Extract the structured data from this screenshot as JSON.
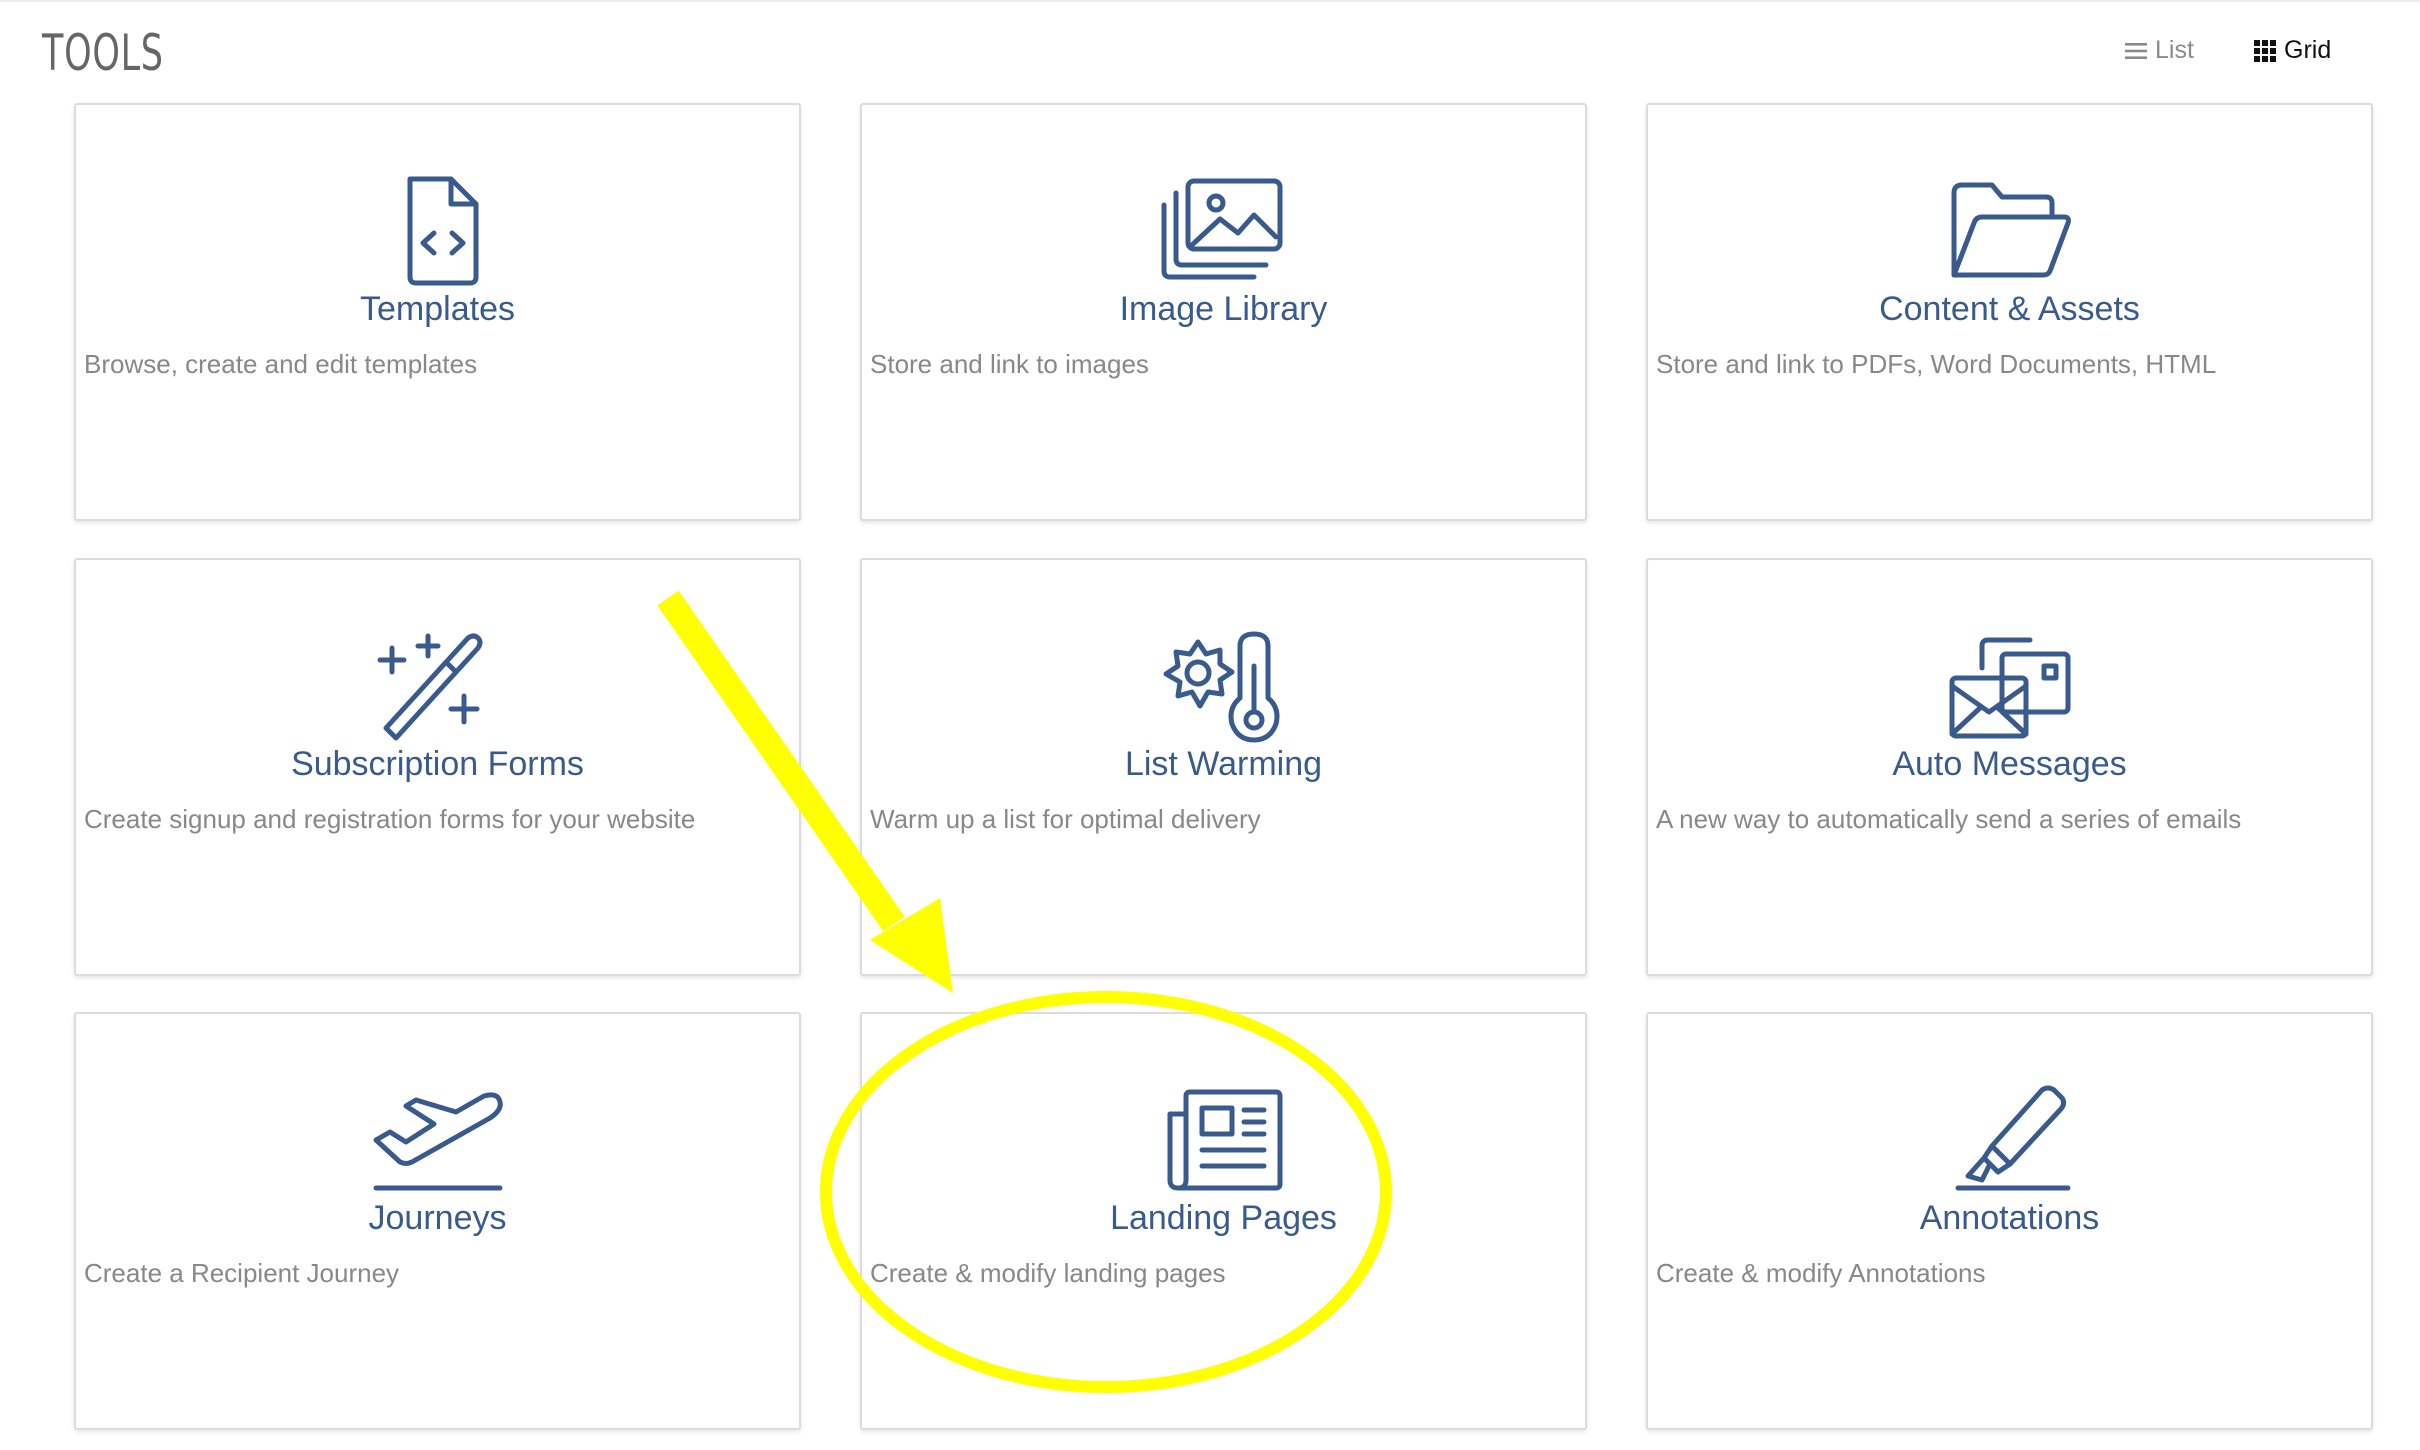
{
  "header": {
    "title": "TOOLS",
    "view_list_label": "List",
    "view_grid_label": "Grid"
  },
  "colors": {
    "accent": "#395a8c",
    "annotation": "#ffff00"
  },
  "cards": [
    {
      "title": "Templates",
      "description": "Browse, create and edit templates",
      "icon": "file-code-icon"
    },
    {
      "title": "Image Library",
      "description": "Store and link to images",
      "icon": "images-icon"
    },
    {
      "title": "Content & Assets",
      "description": "Store and link to PDFs, Word Documents, HTML",
      "icon": "folder-open-icon"
    },
    {
      "title": "Subscription Forms",
      "description": "Create signup and registration forms for your website",
      "icon": "magic-wand-icon"
    },
    {
      "title": "List Warming",
      "description": "Warm up a list for optimal delivery",
      "icon": "sun-thermometer-icon"
    },
    {
      "title": "Auto Messages",
      "description": "A new way to automatically send a series of emails",
      "icon": "envelope-stack-icon"
    },
    {
      "title": "Journeys",
      "description": "Create a Recipient Journey",
      "icon": "plane-departure-icon"
    },
    {
      "title": "Landing Pages",
      "description": "Create & modify landing pages",
      "icon": "newspaper-icon"
    },
    {
      "title": "Annotations",
      "description": "Create & modify Annotations",
      "icon": "highlighter-icon"
    }
  ]
}
